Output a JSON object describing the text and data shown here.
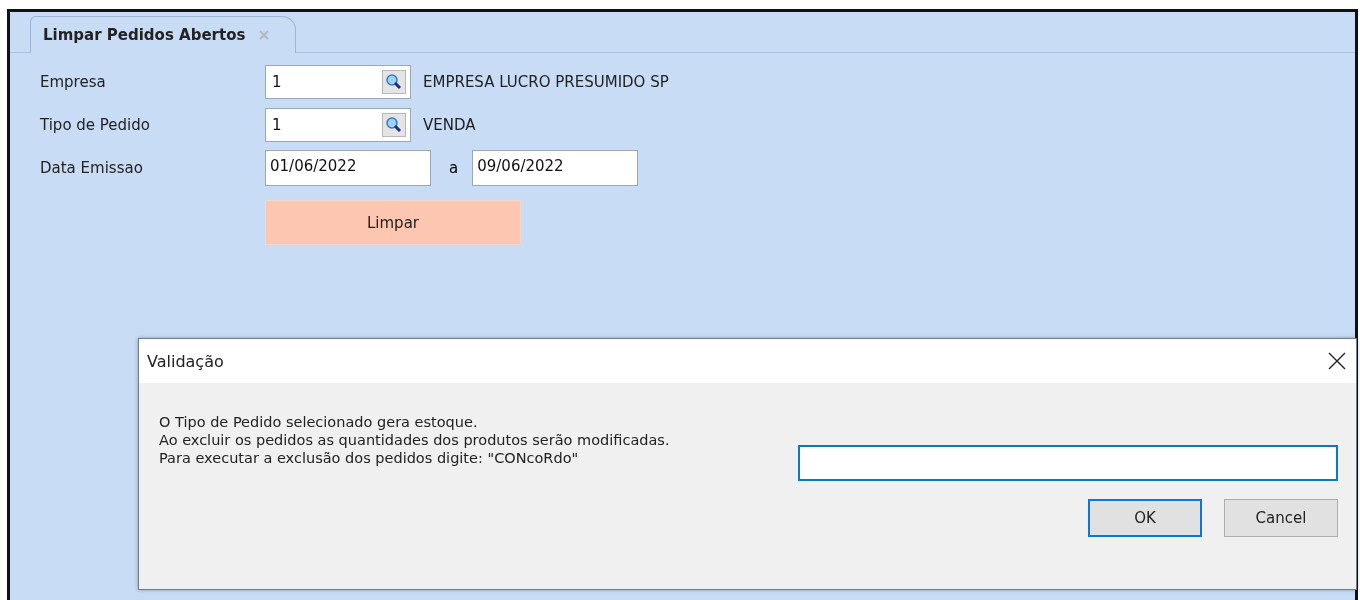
{
  "tab": {
    "title": "Limpar Pedidos Abertos",
    "selected": true
  },
  "form": {
    "rows": [
      {
        "kind": "lookup",
        "label": "Empresa",
        "value": "1",
        "description": "EMPRESA LUCRO PRESUMIDO SP"
      },
      {
        "kind": "lookup",
        "label": "Tipo de Pedido",
        "value": "1",
        "description": "VENDA"
      },
      {
        "kind": "range",
        "label": "Data Emissao",
        "from": "01/06/2022",
        "separator": "a",
        "to": "09/06/2022"
      }
    ],
    "action_button": "Limpar"
  },
  "dialog": {
    "title": "Validação",
    "message": [
      "O Tipo de Pedido selecionado gera estoque.",
      "Ao excluir os pedidos as quantidades dos produtos serão modificadas.",
      "Para executar a exclusão dos pedidos digite: \"CONcoRdo\""
    ],
    "input": {
      "focused": true
    },
    "buttons": [
      {
        "label": "OK",
        "default": true
      },
      {
        "label": "Cancel",
        "default": false
      }
    ]
  }
}
